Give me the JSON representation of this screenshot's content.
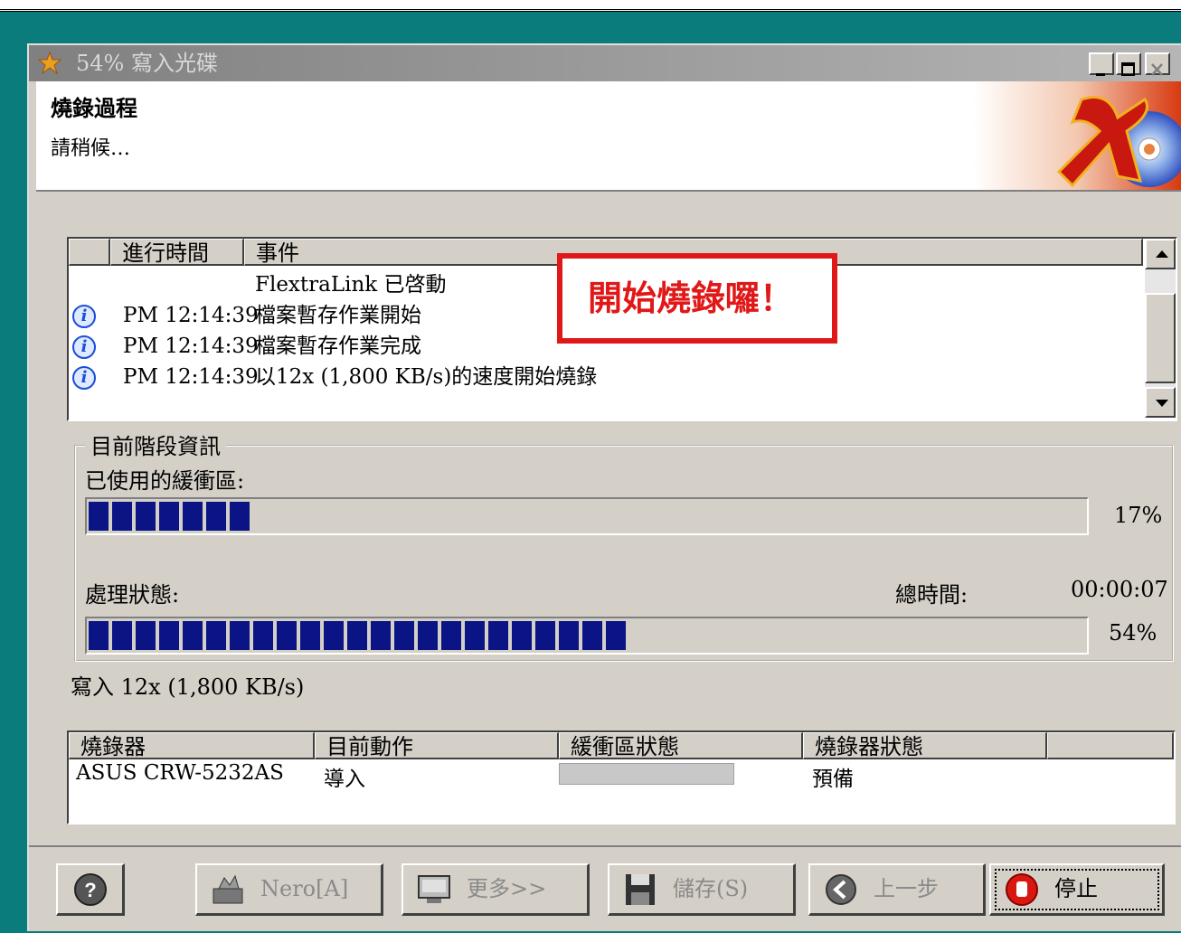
{
  "window": {
    "title": "54% 寫入光碟"
  },
  "header": {
    "title": "燒錄過程",
    "subtitle": "請稍候…"
  },
  "events": {
    "columns": [
      "進行時間",
      "事件"
    ],
    "rows": [
      {
        "time": "",
        "event": "FlextraLink 已啓動",
        "icon": ""
      },
      {
        "time": "PM 12:14:39",
        "event": "檔案暫存作業開始",
        "icon": "info-icon"
      },
      {
        "time": "PM 12:14:39",
        "event": "檔案暫存作業完成",
        "icon": "info-icon"
      },
      {
        "time": "PM 12:14:39",
        "event": "以12x (1,800 KB/s)的速度開始燒錄",
        "icon": "info-icon"
      }
    ]
  },
  "annotation": {
    "text": "開始燒錄囉！",
    "color": "#e01818"
  },
  "stage": {
    "legend": "目前階段資訊",
    "buffer_label": "已使用的緩衝區:",
    "buffer_percent_text": "17%",
    "buffer_fraction": 0.17,
    "process_label": "處理狀態:",
    "total_time_label": "總時間:",
    "total_time": "00:00:07",
    "process_percent_text": "54%",
    "process_fraction": 0.54
  },
  "write_speed": "寫入 12x (1,800 KB/s)",
  "devices": {
    "columns": [
      "燒錄器",
      "目前動作",
      "緩衝區狀態",
      "燒錄器狀態"
    ],
    "rows": [
      {
        "recorder": "ASUS CRW-5232AS",
        "action": "導入",
        "recorder_status": "預備"
      }
    ]
  },
  "buttons": {
    "help": "?",
    "nero": "Nero[A]",
    "more": "更多>>",
    "save": "儲存(S)",
    "back": "上一步",
    "stop": "停止"
  },
  "colors": {
    "progress": "#0a1484",
    "desktop": "#0a7c7c",
    "accent": "#e01818"
  }
}
